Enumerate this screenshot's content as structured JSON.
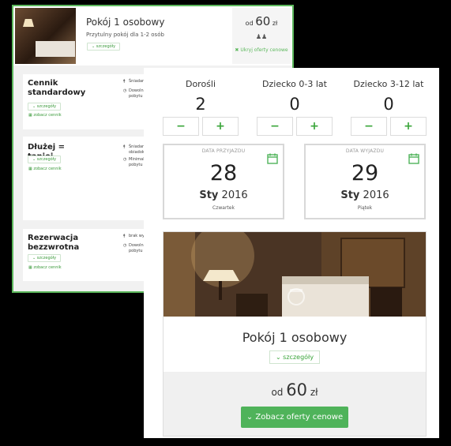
{
  "back": {
    "room_title": "Pokój 1 osobowy",
    "room_subtitle": "Przytulny pokój dla 1-2 osób",
    "details_btn": "⌄ szczegóły",
    "price_prefix": "od",
    "price_value": "60",
    "price_currency": "zł",
    "persons_icon": "persons-icon",
    "hide_offers": "✖ Ukryj oferty cenowe",
    "cards": [
      {
        "title": "Cennik standardowy",
        "details": "⌄ szczegóły",
        "pricing": "▦ zobacz cennik",
        "features": [
          "Śniadanie",
          "Dowolna d",
          "pobytu"
        ]
      },
      {
        "title": "Dłużej = taniej",
        "details": "⌄ szczegóły",
        "pricing": "▦ zobacz cennik",
        "features": [
          "Śniadanie",
          "obiadokol",
          "Minimalna",
          "pobytu 3 n"
        ]
      },
      {
        "title": "Rezerwacja bezzwrotna",
        "details": "⌄ szczegóły",
        "pricing": "▦ zobacz cennik",
        "features": [
          "brak wyży",
          "Dowolna d",
          "pobytu"
        ]
      }
    ]
  },
  "front": {
    "counters": [
      {
        "label": "Dorośli",
        "value": "2"
      },
      {
        "label": "Dziecko 0-3 lat",
        "value": "0"
      },
      {
        "label": "Dziecko 3-12 lat",
        "value": "0"
      }
    ],
    "minus": "−",
    "plus": "+",
    "arrival": {
      "caption": "DATA PRZYJAZDU",
      "day": "28",
      "month": "Sty",
      "year": "2016",
      "weekday": "Czwartek"
    },
    "departure": {
      "caption": "DATA WYJAZDU",
      "day": "29",
      "month": "Sty",
      "year": "2016",
      "weekday": "Piątek"
    },
    "room_title": "Pokój 1 osobowy",
    "room_details": "⌄ szczegóły",
    "price_prefix": "od",
    "price_value": "60",
    "price_currency": "zł",
    "offers_button": "⌄ Zobacz oferty cenowe",
    "accent_color": "#4fb35a"
  }
}
